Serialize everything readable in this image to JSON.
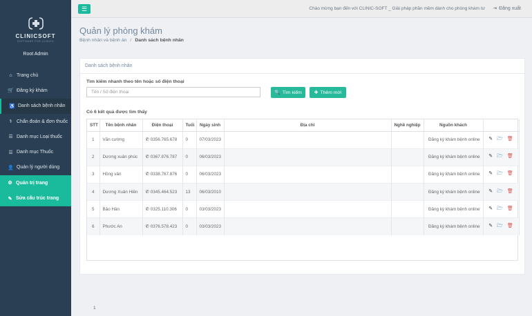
{
  "brand": {
    "name": "CLINICSOFT",
    "subtitle": "SOFTWARE FOR CLINICS"
  },
  "user": {
    "name": "Root Admin"
  },
  "sidebar": {
    "items": [
      {
        "label": "Trang chủ",
        "icon": "home-icon",
        "glyph": "⌂"
      },
      {
        "label": "Đăng ký khám",
        "icon": "cart-icon",
        "glyph": "🛒"
      },
      {
        "label": "Danh sách bệnh nhân",
        "icon": "wheelchair-icon",
        "glyph": "♿"
      },
      {
        "label": "Chẩn đoán & đơn thuốc",
        "icon": "stethoscope-icon",
        "glyph": "⚕"
      },
      {
        "label": "Danh mục Loại thuốc",
        "icon": "list-icon",
        "glyph": "☰"
      },
      {
        "label": "Danh mục Thuốc",
        "icon": "list-icon",
        "glyph": "☰"
      },
      {
        "label": "Quản lý người dùng",
        "icon": "user-icon",
        "glyph": "👤"
      },
      {
        "label": "Quản trị trang",
        "icon": "gear-icon",
        "glyph": "⚙"
      },
      {
        "label": "Sửa cấu trúc trang",
        "icon": "pencil-icon",
        "glyph": "✎"
      }
    ]
  },
  "topbar": {
    "welcome": "Chào mừng bạn đến với CLINIC-SOFT _ Giải pháp phần mềm dành cho phòng khám tư",
    "logout": "Đăng xuất"
  },
  "page": {
    "title": "Quản lý phòng khám",
    "breadcrumb": [
      "Bệnh nhân và bệnh án",
      "Danh sách bệnh nhân"
    ]
  },
  "panel": {
    "title": "Danh sách bệnh nhân",
    "search_label": "Tìm kiếm nhanh theo tên hoặc số điện thoại",
    "search_placeholder": "Tên / Số điện thoại",
    "search_value": "",
    "search_button": "Tìm kiếm",
    "add_button": "Thêm mới",
    "result_count": "Có 6 kết quả được tìm thấy"
  },
  "table": {
    "columns": [
      "STT",
      "Tên bệnh nhân",
      "Điện thoại",
      "Tuổi",
      "Ngày sinh",
      "Địa chỉ",
      "Nghề nghiệp",
      "Nguồn khách",
      ""
    ],
    "rows": [
      {
        "stt": "1",
        "name": "Văn cường",
        "phone": "0356.765.678",
        "age": "0",
        "dob": "07/03/2023",
        "address": "",
        "job": "",
        "source": "Đăng ký khám bệnh online"
      },
      {
        "stt": "2",
        "name": "Dương xuân phúc",
        "phone": "0367.876.787",
        "age": "0",
        "dob": "06/03/2023",
        "address": "",
        "job": "",
        "source": "Đăng ký khám bệnh online"
      },
      {
        "stt": "3",
        "name": "Hồng vân",
        "phone": "0338.767.876",
        "age": "0",
        "dob": "06/03/2023",
        "address": "",
        "job": "",
        "source": "Đăng ký khám bệnh online"
      },
      {
        "stt": "4",
        "name": "Dương Xuân Hiền",
        "phone": "0345.464.523",
        "age": "13",
        "dob": "06/03/2010",
        "address": "",
        "job": "",
        "source": "Đăng ký khám bệnh online"
      },
      {
        "stt": "5",
        "name": "Bảo Hân",
        "phone": "0325.110.306",
        "age": "0",
        "dob": "03/03/2023",
        "address": "",
        "job": "",
        "source": "Đăng ký khám bệnh online"
      },
      {
        "stt": "6",
        "name": "Phước An",
        "phone": "0376.578.423",
        "age": "0",
        "dob": "03/03/2023",
        "address": "",
        "job": "",
        "source": "Đăng ký khám bệnh online"
      }
    ],
    "page": "1"
  },
  "colors": {
    "sidebar": "#2a3f54",
    "accent": "#1abb9c",
    "button": "#26b99a",
    "delete": "#d9534f"
  }
}
